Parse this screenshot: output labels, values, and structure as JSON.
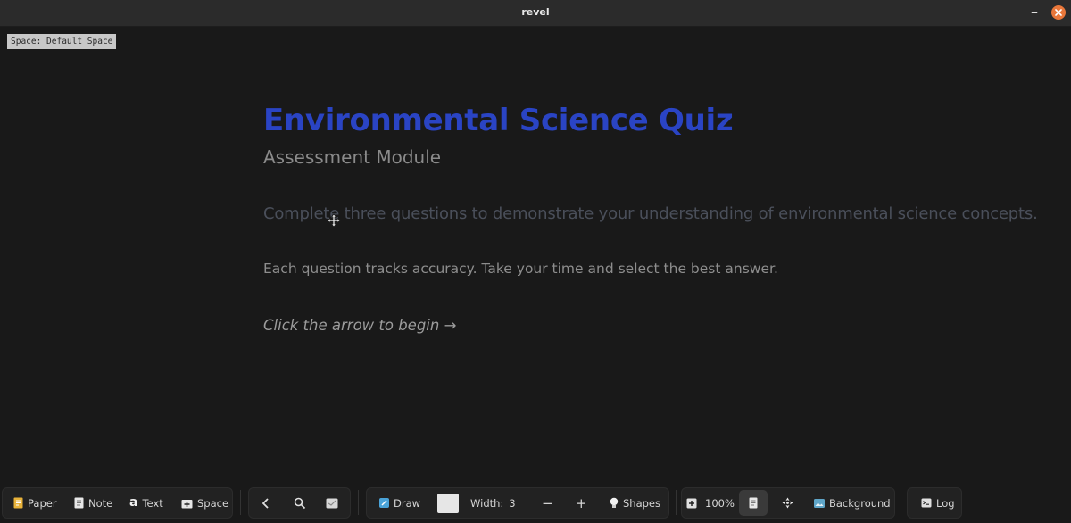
{
  "window": {
    "title": "revel"
  },
  "space_label": "Space: Default Space",
  "content": {
    "title": "Environmental Science Quiz",
    "subtitle": "Assessment Module",
    "intro": "Complete three questions to demonstrate your understanding of environmental science concepts.",
    "instructions": "Each question tracks accuracy. Take your time and select the best answer.",
    "cta": "Click the arrow to begin →"
  },
  "toolbar": {
    "paper": "Paper",
    "note": "Note",
    "text": "Text",
    "space": "Space",
    "draw": "Draw",
    "width_label": "Width:",
    "width_value": "3",
    "shapes": "Shapes",
    "zoom": "100%",
    "background": "Background",
    "log": "Log"
  },
  "colors": {
    "title_blue": "#2a44c4",
    "close_orange": "#e9773a",
    "canvas_bg": "#191919"
  }
}
